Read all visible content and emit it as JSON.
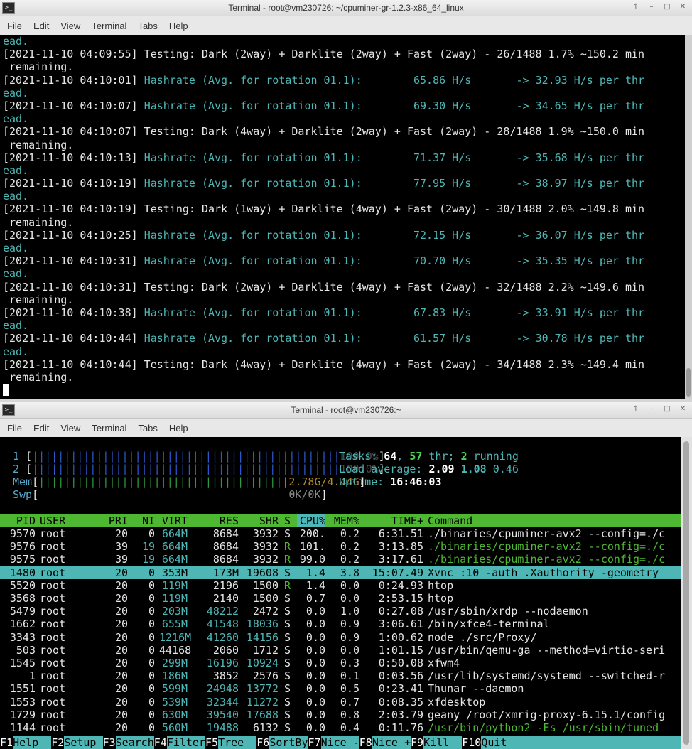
{
  "window1": {
    "title": "Terminal - root@vm230726: ~/cpuminer-gr-1.2.3-x86_64_linux",
    "controls": [
      "↑",
      "–",
      "□",
      "✕"
    ],
    "menu": [
      "File",
      "Edit",
      "View",
      "Terminal",
      "Tabs",
      "Help"
    ],
    "lines": [
      {
        "text": "ead.",
        "color": "cyan"
      },
      {
        "text": "[2021-11-10 04:09:55] Testing: Dark (2way) + Darklite (2way) + Fast (2way) - 26/1488 1.7% ~150.2 min"
      },
      {
        "text": " remaining."
      },
      {
        "ts": "[2021-11-10 04:10:01] ",
        "rest": "Hashrate (Avg. for rotation 01.1):        65.86 H/s       -> 32.93 H/s per thr"
      },
      {
        "text": "ead.",
        "color": "cyan"
      },
      {
        "ts": "[2021-11-10 04:10:07] ",
        "rest": "Hashrate (Avg. for rotation 01.1):        69.30 H/s       -> 34.65 H/s per thr"
      },
      {
        "text": "ead.",
        "color": "cyan"
      },
      {
        "text": "[2021-11-10 04:10:07] Testing: Dark (4way) + Darklite (2way) + Fast (2way) - 28/1488 1.9% ~150.0 min"
      },
      {
        "text": " remaining."
      },
      {
        "ts": "[2021-11-10 04:10:13] ",
        "rest": "Hashrate (Avg. for rotation 01.1):        71.37 H/s       -> 35.68 H/s per thr"
      },
      {
        "text": "ead.",
        "color": "cyan"
      },
      {
        "ts": "[2021-11-10 04:10:19] ",
        "rest": "Hashrate (Avg. for rotation 01.1):        77.95 H/s       -> 38.97 H/s per thr"
      },
      {
        "text": "ead.",
        "color": "cyan"
      },
      {
        "text": "[2021-11-10 04:10:19] Testing: Dark (1way) + Darklite (4way) + Fast (2way) - 30/1488 2.0% ~149.8 min"
      },
      {
        "text": " remaining."
      },
      {
        "ts": "[2021-11-10 04:10:25] ",
        "rest": "Hashrate (Avg. for rotation 01.1):        72.15 H/s       -> 36.07 H/s per thr"
      },
      {
        "text": "ead.",
        "color": "cyan"
      },
      {
        "ts": "[2021-11-10 04:10:31] ",
        "rest": "Hashrate (Avg. for rotation 01.1):        70.70 H/s       -> 35.35 H/s per thr"
      },
      {
        "text": "ead.",
        "color": "cyan"
      },
      {
        "text": "[2021-11-10 04:10:31] Testing: Dark (2way) + Darklite (4way) + Fast (2way) - 32/1488 2.2% ~149.6 min"
      },
      {
        "text": " remaining."
      },
      {
        "ts": "[2021-11-10 04:10:38] ",
        "rest": "Hashrate (Avg. for rotation 01.1):        67.83 H/s       -> 33.91 H/s per thr"
      },
      {
        "text": "ead.",
        "color": "cyan"
      },
      {
        "ts": "[2021-11-10 04:10:44] ",
        "rest": "Hashrate (Avg. for rotation 01.1):        61.57 H/s       -> 30.78 H/s per thr"
      },
      {
        "text": "ead.",
        "color": "cyan"
      },
      {
        "text": "[2021-11-10 04:10:44] Testing: Dark (4way) + Darklite (4way) + Fast (2way) - 34/1488 2.3% ~149.4 min"
      },
      {
        "text": " remaining."
      }
    ]
  },
  "window2": {
    "title": "Terminal - root@vm230726:~",
    "controls": [
      "↑",
      "–",
      "□",
      "✕"
    ],
    "menu": [
      "File",
      "Edit",
      "View",
      "Terminal",
      "Tabs",
      "Help"
    ],
    "meters": {
      "cpu1": {
        "label": "1",
        "value": "100.0%"
      },
      "cpu2": {
        "label": "2",
        "value": "100.0%"
      },
      "mem": {
        "label": "Mem",
        "value": "2.78G/4.44G"
      },
      "swp": {
        "label": "Swp",
        "value": "0K/0K"
      }
    },
    "info": {
      "tasks_label": "Tasks: ",
      "tasks": "64",
      "thr": "57",
      "thr_label": " thr; ",
      "running": "2",
      "running_label": " running",
      "load_label": "Load average: ",
      "load1": "2.09",
      "load5": "1.08",
      "load15": "0.46",
      "uptime_label": "Uptime: ",
      "uptime": "16:46:03"
    },
    "columns": [
      "PID",
      "USER",
      "PRI",
      "NI",
      "VIRT",
      "RES",
      "SHR",
      "S",
      "CPU%",
      "MEM%",
      "TIME+",
      "Command"
    ],
    "processes": [
      {
        "pid": "9570",
        "user": "root",
        "pri": "20",
        "ni": "0",
        "virt": "664M",
        "res": "8684",
        "shr": "3932",
        "s": "S",
        "cpu": "200.",
        "mem": "0.2",
        "time": "6:31.51",
        "cmd": "./binaries/cpuminer-avx2 --config=./c"
      },
      {
        "pid": "9576",
        "user": "root",
        "pri": "39",
        "ni": "19",
        "virt": "664M",
        "res": "8684",
        "shr": "3932",
        "s": "R",
        "cpu": "101.",
        "mem": "0.2",
        "time": "3:13.85",
        "cmd": "./binaries/cpuminer-avx2 --config=./c"
      },
      {
        "pid": "9575",
        "user": "root",
        "pri": "39",
        "ni": "19",
        "virt": "664M",
        "res": "8684",
        "shr": "3932",
        "s": "R",
        "cpu": "99.0",
        "mem": "0.2",
        "time": "3:17.61",
        "cmd": "./binaries/cpuminer-avx2 --config=./c"
      },
      {
        "pid": "1480",
        "user": "root",
        "pri": "20",
        "ni": "0",
        "virt": "353M",
        "res": "173M",
        "shr": "19608",
        "s": "S",
        "cpu": "1.4",
        "mem": "3.8",
        "time": "15:07.49",
        "cmd": "Xvnc :10 -auth .Xauthority -geometry"
      },
      {
        "pid": "5520",
        "user": "root",
        "pri": "20",
        "ni": "0",
        "virt": "119M",
        "res": "2196",
        "shr": "1500",
        "s": "R",
        "cpu": "1.4",
        "mem": "0.0",
        "time": "0:24.93",
        "cmd": "htop"
      },
      {
        "pid": "3568",
        "user": "root",
        "pri": "20",
        "ni": "0",
        "virt": "119M",
        "res": "2140",
        "shr": "1500",
        "s": "S",
        "cpu": "0.7",
        "mem": "0.0",
        "time": "2:53.15",
        "cmd": "htop"
      },
      {
        "pid": "5479",
        "user": "root",
        "pri": "20",
        "ni": "0",
        "virt": "203M",
        "res": "48212",
        "shr": "2472",
        "s": "S",
        "cpu": "0.0",
        "mem": "1.0",
        "time": "0:27.08",
        "cmd": "/usr/sbin/xrdp --nodaemon"
      },
      {
        "pid": "1662",
        "user": "root",
        "pri": "20",
        "ni": "0",
        "virt": "655M",
        "res": "41548",
        "shr": "18036",
        "s": "S",
        "cpu": "0.0",
        "mem": "0.9",
        "time": "3:06.61",
        "cmd": "/bin/xfce4-terminal"
      },
      {
        "pid": "3343",
        "user": "root",
        "pri": "20",
        "ni": "0",
        "virt": "1216M",
        "res": "41260",
        "shr": "14156",
        "s": "S",
        "cpu": "0.0",
        "mem": "0.9",
        "time": "1:00.62",
        "cmd": "node ./src/Proxy/"
      },
      {
        "pid": "503",
        "user": "root",
        "pri": "20",
        "ni": "0",
        "virt": "44168",
        "res": "2060",
        "shr": "1712",
        "s": "S",
        "cpu": "0.0",
        "mem": "0.0",
        "time": "1:01.15",
        "cmd": "/usr/bin/qemu-ga --method=virtio-seri"
      },
      {
        "pid": "1545",
        "user": "root",
        "pri": "20",
        "ni": "0",
        "virt": "299M",
        "res": "16196",
        "shr": "10924",
        "s": "S",
        "cpu": "0.0",
        "mem": "0.3",
        "time": "0:50.08",
        "cmd": "xfwm4"
      },
      {
        "pid": "1",
        "user": "root",
        "pri": "20",
        "ni": "0",
        "virt": "186M",
        "res": "3852",
        "shr": "2576",
        "s": "S",
        "cpu": "0.0",
        "mem": "0.1",
        "time": "0:03.56",
        "cmd": "/usr/lib/systemd/systemd --switched-r"
      },
      {
        "pid": "1551",
        "user": "root",
        "pri": "20",
        "ni": "0",
        "virt": "599M",
        "res": "24948",
        "shr": "13772",
        "s": "S",
        "cpu": "0.0",
        "mem": "0.5",
        "time": "0:23.41",
        "cmd": "Thunar --daemon"
      },
      {
        "pid": "1553",
        "user": "root",
        "pri": "20",
        "ni": "0",
        "virt": "539M",
        "res": "32344",
        "shr": "11272",
        "s": "S",
        "cpu": "0.0",
        "mem": "0.7",
        "time": "0:08.35",
        "cmd": "xfdesktop"
      },
      {
        "pid": "1729",
        "user": "root",
        "pri": "20",
        "ni": "0",
        "virt": "630M",
        "res": "39540",
        "shr": "17688",
        "s": "S",
        "cpu": "0.0",
        "mem": "0.8",
        "time": "2:03.79",
        "cmd": "geany /root/xmrig-proxy-6.15.1/config"
      },
      {
        "pid": "1144",
        "user": "root",
        "pri": "20",
        "ni": "0",
        "virt": "560M",
        "res": "19488",
        "shr": "6132",
        "s": "S",
        "cpu": "0.0",
        "mem": "0.4",
        "time": "0:11.76",
        "cmd": "/usr/bin/python2 -Es /usr/sbin/tuned"
      }
    ],
    "fkeys": [
      {
        "key": "F1",
        "label": "Help  "
      },
      {
        "key": "F2",
        "label": "Setup "
      },
      {
        "key": "F3",
        "label": "Search"
      },
      {
        "key": "F4",
        "label": "Filter"
      },
      {
        "key": "F5",
        "label": "Tree  "
      },
      {
        "key": "F6",
        "label": "SortBy"
      },
      {
        "key": "F7",
        "label": "Nice -"
      },
      {
        "key": "F8",
        "label": "Nice +"
      },
      {
        "key": "F9",
        "label": "Kill  "
      },
      {
        "key": "F10",
        "label": "Quit  "
      }
    ],
    "colors": {
      "header": "#4fb833",
      "selected": "#4fb6b6",
      "cpu_bar": "#2e58c8",
      "mem_bar": "#2f9a3f"
    }
  }
}
